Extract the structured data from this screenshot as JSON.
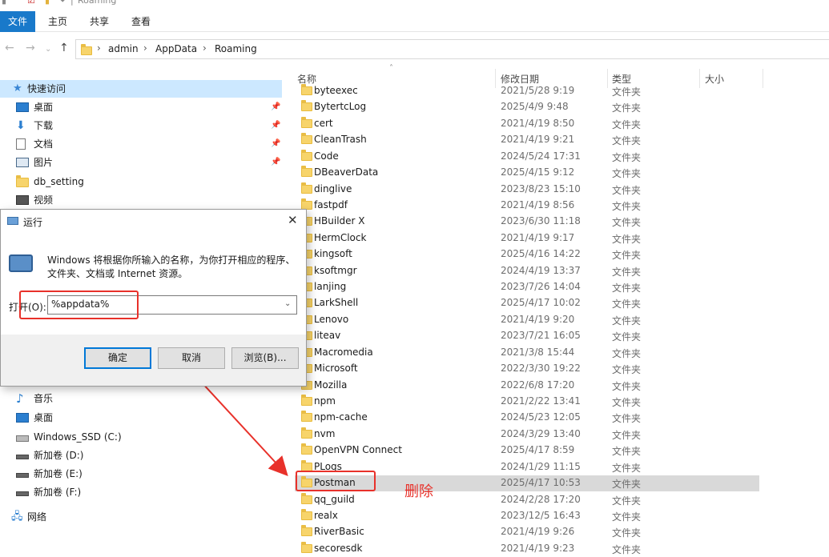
{
  "window": {
    "title_fragment": "Roaming",
    "ribbon_tabs": [
      "文件",
      "主页",
      "共享",
      "查看"
    ]
  },
  "address_bar": {
    "crumbs": [
      "admin",
      "AppData",
      "Roaming"
    ]
  },
  "nav_pane": {
    "quick_access": "快速访问",
    "pinned": [
      "桌面",
      "下载",
      "文档",
      "图片"
    ],
    "items": [
      "db_setting",
      "视频"
    ],
    "this_pc": [
      "音乐",
      "桌面",
      "Windows_SSD (C:)",
      "新加卷 (D:)",
      "新加卷 (E:)",
      "新加卷 (F:)"
    ],
    "network": "网络"
  },
  "file_list": {
    "columns": {
      "name": "名称",
      "modified": "修改日期",
      "type": "类型",
      "size": "大小"
    },
    "rows": [
      {
        "name": "byteexec",
        "date": "2021/5/28 9:19",
        "type": "文件夹"
      },
      {
        "name": "BytertcLog",
        "date": "2025/4/9 9:48",
        "type": "文件夹"
      },
      {
        "name": "cert",
        "date": "2021/4/19 8:50",
        "type": "文件夹"
      },
      {
        "name": "CleanTrash",
        "date": "2021/4/19 9:21",
        "type": "文件夹"
      },
      {
        "name": "Code",
        "date": "2024/5/24 17:31",
        "type": "文件夹"
      },
      {
        "name": "DBeaverData",
        "date": "2025/4/15 9:12",
        "type": "文件夹"
      },
      {
        "name": "dinglive",
        "date": "2023/8/23 15:10",
        "type": "文件夹"
      },
      {
        "name": "fastpdf",
        "date": "2021/4/19 8:56",
        "type": "文件夹"
      },
      {
        "name": "HBuilder X",
        "date": "2023/6/30 11:18",
        "type": "文件夹"
      },
      {
        "name": "HermClock",
        "date": "2021/4/19 9:17",
        "type": "文件夹"
      },
      {
        "name": "kingsoft",
        "date": "2025/4/16 14:22",
        "type": "文件夹"
      },
      {
        "name": "ksoftmgr",
        "date": "2024/4/19 13:37",
        "type": "文件夹"
      },
      {
        "name": "lanjing",
        "date": "2023/7/26 14:04",
        "type": "文件夹"
      },
      {
        "name": "LarkShell",
        "date": "2025/4/17 10:02",
        "type": "文件夹"
      },
      {
        "name": "Lenovo",
        "date": "2021/4/19 9:20",
        "type": "文件夹"
      },
      {
        "name": "liteav",
        "date": "2023/7/21 16:05",
        "type": "文件夹"
      },
      {
        "name": "Macromedia",
        "date": "2021/3/8 15:44",
        "type": "文件夹"
      },
      {
        "name": "Microsoft",
        "date": "2022/3/30 19:22",
        "type": "文件夹"
      },
      {
        "name": "Mozilla",
        "date": "2022/6/8 17:20",
        "type": "文件夹"
      },
      {
        "name": "npm",
        "date": "2021/2/22 13:41",
        "type": "文件夹"
      },
      {
        "name": "npm-cache",
        "date": "2024/5/23 12:05",
        "type": "文件夹"
      },
      {
        "name": "nvm",
        "date": "2024/3/29 13:40",
        "type": "文件夹"
      },
      {
        "name": "OpenVPN Connect",
        "date": "2025/4/17 8:59",
        "type": "文件夹"
      },
      {
        "name": "PLogs",
        "date": "2024/1/29 11:15",
        "type": "文件夹"
      },
      {
        "name": "Postman",
        "date": "2025/4/17 10:53",
        "type": "文件夹",
        "selected": true
      },
      {
        "name": "qq_guild",
        "date": "2024/2/28 17:20",
        "type": "文件夹"
      },
      {
        "name": "realx",
        "date": "2023/12/5 16:43",
        "type": "文件夹"
      },
      {
        "name": "RiverBasic",
        "date": "2021/4/19 9:26",
        "type": "文件夹"
      },
      {
        "name": "secoresdk",
        "date": "2021/4/19 9:23",
        "type": "文件夹"
      }
    ]
  },
  "run_dialog": {
    "title": "运行",
    "description_line1": "Windows 将根据你所输入的名称，为你打开相应的程序、",
    "description_line2": "文件夹、文档或 Internet 资源。",
    "open_label": "打开(O):",
    "input_value": "%appdata%",
    "ok_label": "确定",
    "cancel_label": "取消",
    "browse_label": "浏览(B)..."
  },
  "annotation": {
    "delete_label": "删除",
    "color": "#e8312a"
  }
}
